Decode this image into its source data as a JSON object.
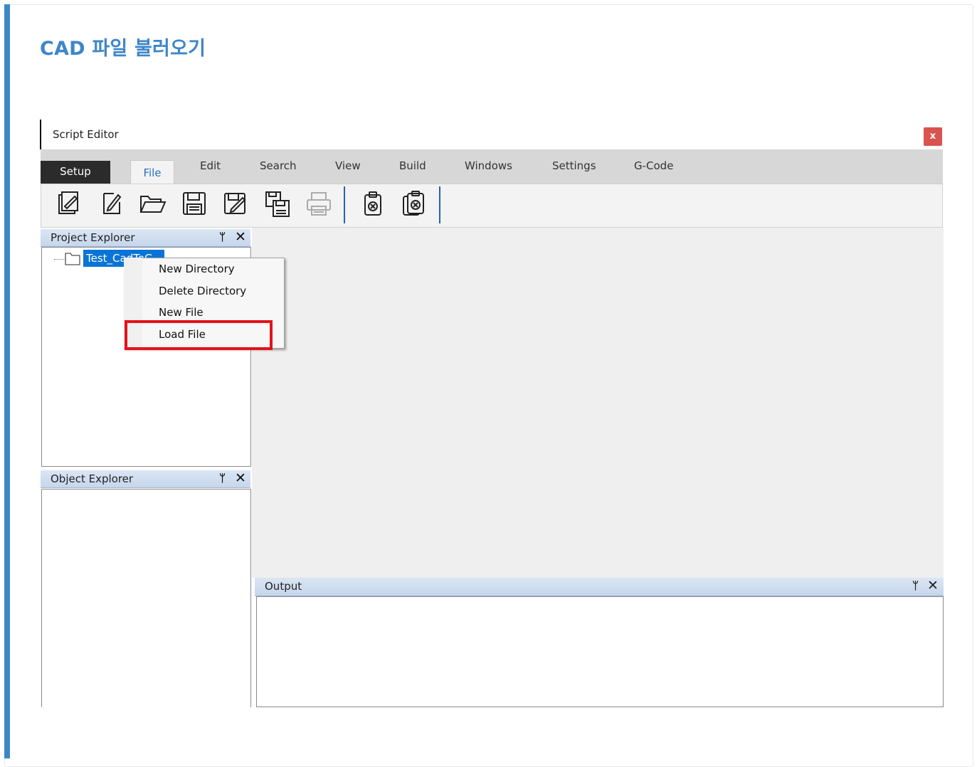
{
  "page": {
    "title": "CAD 파일 불러오기"
  },
  "window": {
    "title": "Script Editor",
    "close_label": "x"
  },
  "menu": {
    "items": [
      "Setup",
      "File",
      "Edit",
      "Search",
      "View",
      "Build",
      "Windows",
      "Settings",
      "G-Code"
    ],
    "active": "File"
  },
  "toolbar": {
    "buttons": [
      "copy-edit-icon",
      "edit-icon",
      "open-folder-icon",
      "save-icon",
      "save-as-icon",
      "save-all-icon",
      "print-icon",
      "clear-icon",
      "clear-all-icon"
    ]
  },
  "project_explorer": {
    "title": "Project Explorer",
    "pin": "⊥",
    "close": "✕",
    "tree": [
      {
        "label": "Test_CadToG",
        "selected": true
      }
    ]
  },
  "context_menu": {
    "items": [
      "New Directory",
      "Delete Directory",
      "New File",
      "Load File"
    ],
    "highlighted": "Load File",
    "highlight_color": "#e3121b"
  },
  "object_explorer": {
    "title": "Object Explorer",
    "pin": "⊥",
    "close": "✕"
  },
  "output": {
    "title": "Output",
    "pin": "⊥",
    "close": "✕"
  },
  "colors": {
    "accent": "#3d86c6",
    "title_blue": "#3f86c8",
    "selection": "#0a74d6",
    "close_button": "#d9534f"
  }
}
